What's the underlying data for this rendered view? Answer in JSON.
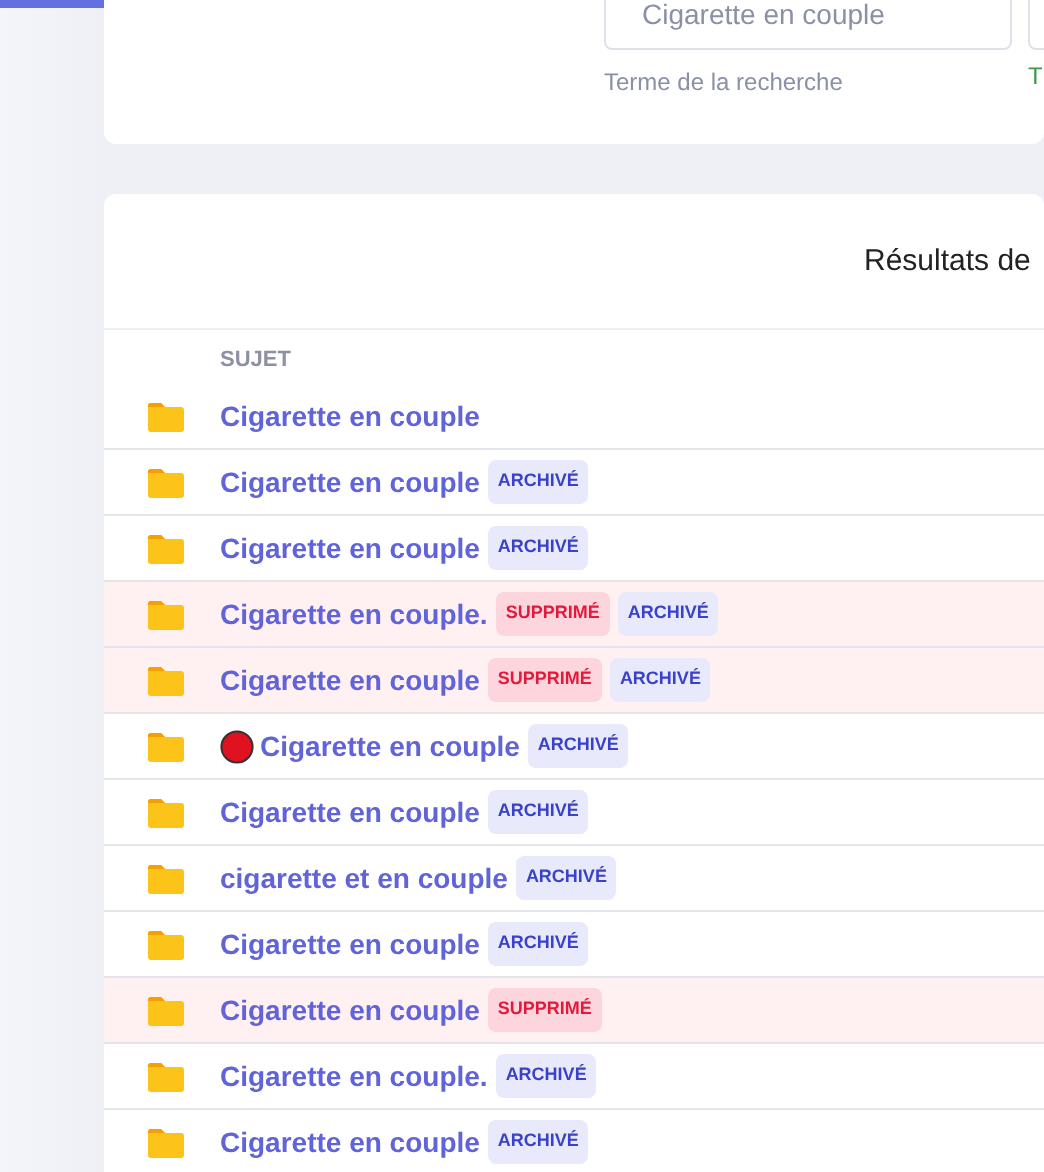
{
  "search": {
    "value": "Cigarette en couple",
    "label": "Terme de la recherche",
    "second_label": "T"
  },
  "results": {
    "title": "Résultats de",
    "column": "SUJET",
    "rows": [
      {
        "subject": "Cigarette en couple",
        "deleted": false,
        "dot": false,
        "tags": []
      },
      {
        "subject": "Cigarette en couple",
        "deleted": false,
        "dot": false,
        "tags": [
          {
            "label": "ARCHIVÉ",
            "kind": "archived"
          }
        ]
      },
      {
        "subject": "Cigarette en couple",
        "deleted": false,
        "dot": false,
        "tags": [
          {
            "label": "ARCHIVÉ",
            "kind": "archived"
          }
        ]
      },
      {
        "subject": "Cigarette en couple.",
        "deleted": true,
        "dot": false,
        "tags": [
          {
            "label": "SUPPRIMÉ",
            "kind": "deleted"
          },
          {
            "label": "ARCHIVÉ",
            "kind": "archived"
          }
        ]
      },
      {
        "subject": "Cigarette en couple",
        "deleted": true,
        "dot": false,
        "tags": [
          {
            "label": "SUPPRIMÉ",
            "kind": "deleted"
          },
          {
            "label": "ARCHIVÉ",
            "kind": "archived"
          }
        ]
      },
      {
        "subject": "Cigarette en couple",
        "deleted": false,
        "dot": true,
        "tags": [
          {
            "label": "ARCHIVÉ",
            "kind": "archived"
          }
        ]
      },
      {
        "subject": "Cigarette en couple",
        "deleted": false,
        "dot": false,
        "tags": [
          {
            "label": "ARCHIVÉ",
            "kind": "archived"
          }
        ]
      },
      {
        "subject": "cigarette et en couple",
        "deleted": false,
        "dot": false,
        "tags": [
          {
            "label": "ARCHIVÉ",
            "kind": "archived"
          }
        ]
      },
      {
        "subject": "Cigarette en couple",
        "deleted": false,
        "dot": false,
        "tags": [
          {
            "label": "ARCHIVÉ",
            "kind": "archived"
          }
        ]
      },
      {
        "subject": "Cigarette en couple",
        "deleted": true,
        "dot": false,
        "tags": [
          {
            "label": "SUPPRIMÉ",
            "kind": "deleted"
          }
        ]
      },
      {
        "subject": "Cigarette en couple.",
        "deleted": false,
        "dot": false,
        "tags": [
          {
            "label": "ARCHIVÉ",
            "kind": "archived"
          }
        ]
      },
      {
        "subject": "Cigarette en couple",
        "deleted": false,
        "dot": false,
        "tags": [
          {
            "label": "ARCHIVÉ",
            "kind": "archived"
          }
        ]
      }
    ]
  }
}
